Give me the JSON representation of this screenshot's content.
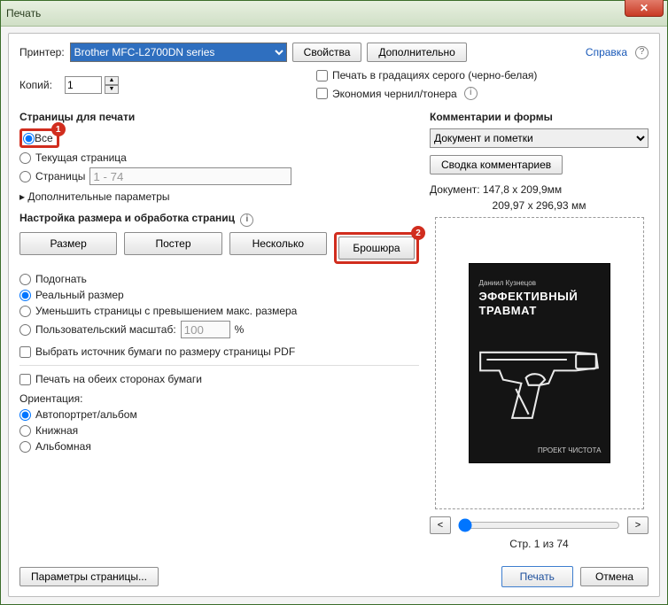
{
  "window": {
    "title": "Печать"
  },
  "top": {
    "printer_label": "Принтер:",
    "printer_value": "Brother MFC-L2700DN series",
    "properties": "Свойства",
    "advanced": "Дополнительно",
    "help": "Справка",
    "copies_label": "Копий:",
    "copies_value": "1",
    "grayscale": "Печать в градациях серого (черно-белая)",
    "save_ink": "Экономия чернил/тонера"
  },
  "pages": {
    "title": "Страницы для печати",
    "all": "Все",
    "current": "Текущая страница",
    "range_label": "Страницы",
    "range_value": "1 - 74",
    "more": "Дополнительные параметры"
  },
  "sizing": {
    "title": "Настройка размера и обработка страниц",
    "tabs": [
      "Размер",
      "Постер",
      "Несколько",
      "Брошюра"
    ],
    "fit": "Подогнать",
    "actual": "Реальный размер",
    "shrink": "Уменьшить страницы с превышением макс. размера",
    "custom": "Пользовательский масштаб:",
    "custom_value": "100",
    "percent": "%",
    "paper_source": "Выбрать источник бумаги по размеру страницы PDF",
    "duplex": "Печать на обеих сторонах бумаги"
  },
  "orient": {
    "title": "Ориентация:",
    "auto": "Автопортрет/альбом",
    "portrait": "Книжная",
    "landscape": "Альбомная"
  },
  "comments": {
    "title": "Комментарии и формы",
    "value": "Документ и пометки",
    "summary": "Сводка комментариев"
  },
  "preview": {
    "doc_label": "Документ:",
    "doc_dims": "147,8 x 209,9мм",
    "page_dims": "209,97 x 296,93 мм",
    "page_of": "Стр. 1 из 74",
    "cover": {
      "author": "Даниил Кузнецов",
      "title1": "ЭФФЕКТИВНЫЙ",
      "title2": "ТРАВМАТ",
      "project": "ПРОЕКТ ЧИСТОТА"
    }
  },
  "bottom": {
    "page_setup": "Параметры страницы...",
    "print": "Печать",
    "cancel": "Отмена"
  },
  "annotations": {
    "one": "1",
    "two": "2"
  }
}
